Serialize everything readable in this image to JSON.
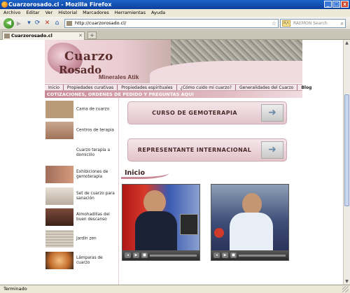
{
  "window": {
    "title": "Cuarzorosado.cl - Mozilla Firefox",
    "min": "_",
    "max": "□",
    "close": "x"
  },
  "menu": [
    "Archivo",
    "Editar",
    "Ver",
    "Historial",
    "Marcadores",
    "Herramientas",
    "Ayuda"
  ],
  "navbar": {
    "url": "http://cuarzorosado.cl/",
    "search_placeholder": "RAEMON Search",
    "search_engine": "RΛ"
  },
  "tabs": {
    "active": "Cuarzorosado.cl",
    "new_tab": "+"
  },
  "status": "Terminado",
  "site": {
    "logo_line1": "Cuarzo",
    "logo_line2": "Rosado",
    "logo_line3": "Minerales Atik",
    "nav": [
      "Inicio",
      "Propiedades curativas",
      "Propiedades espirituales",
      "¿Cómo cuido mi cuarzo?",
      "Generalidades del Cuarzo",
      "Blog"
    ],
    "banner": "COTIZACIONES, ORDENES DE PEDIDO Y PREGUNTAS AQUI",
    "categories": [
      {
        "label": "Cama de cuarzo",
        "color": "#b89a78"
      },
      {
        "label": "Centros de terapia",
        "color": "#c9a890"
      },
      {
        "label": "Cuarzo terapia a domicilio",
        "color": "#ffffff"
      },
      {
        "label": "Exhibiciones de gemoterapia",
        "color": "#a06e5a"
      },
      {
        "label": "Set de cuarzo para sanación",
        "color": "#d8cfc4"
      },
      {
        "label": "Almohadillas del buen descanso",
        "color": "#7a4a3a"
      },
      {
        "label": "Jardín zen",
        "color": "#d9d2c6"
      },
      {
        "label": "Lámparas de cuarzo",
        "color": "#e2a060"
      }
    ],
    "promo1": "CURSO DE GEMOTERAPIA",
    "promo2": "REPRESENTANTE INTERNACIONAL",
    "promo_arrow": "➜",
    "section_title": "Inicio",
    "video_controls": [
      "◂",
      "▶",
      "■"
    ]
  }
}
